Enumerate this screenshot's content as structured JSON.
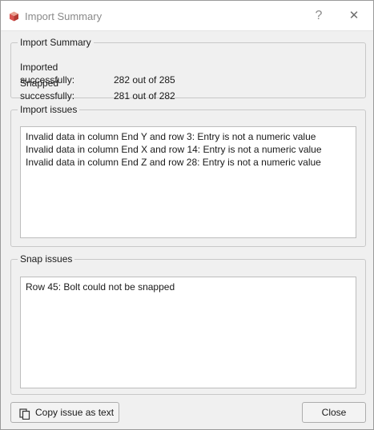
{
  "window": {
    "title": "Import Summary",
    "help_label": "?",
    "close_glyph": "✕"
  },
  "summary": {
    "group_title": "Import Summary",
    "imported_label": "Imported successfully:",
    "imported_value": "282 out of 285",
    "snapped_label": "Snapped successfully:",
    "snapped_value": "281 out of 282"
  },
  "import_issues": {
    "group_title": "Import issues",
    "items": [
      "Invalid data in column End Y and row 3: Entry is not a numeric value",
      "Invalid data in column End X and row 14: Entry is not a numeric value",
      "Invalid data in column End Z and row 28: Entry is not a numeric value"
    ]
  },
  "snap_issues": {
    "group_title": "Snap issues",
    "items": [
      "Row 45: Bolt could not be snapped"
    ]
  },
  "buttons": {
    "copy_label": "Copy issue as text",
    "close_label": "Close"
  },
  "icons": {
    "app": "app-cube-icon",
    "copy": "copy-icon"
  },
  "colors": {
    "app_icon": "#d9534f",
    "window_bg": "#f0f0f0",
    "titlebar_bg": "#ffffff"
  }
}
